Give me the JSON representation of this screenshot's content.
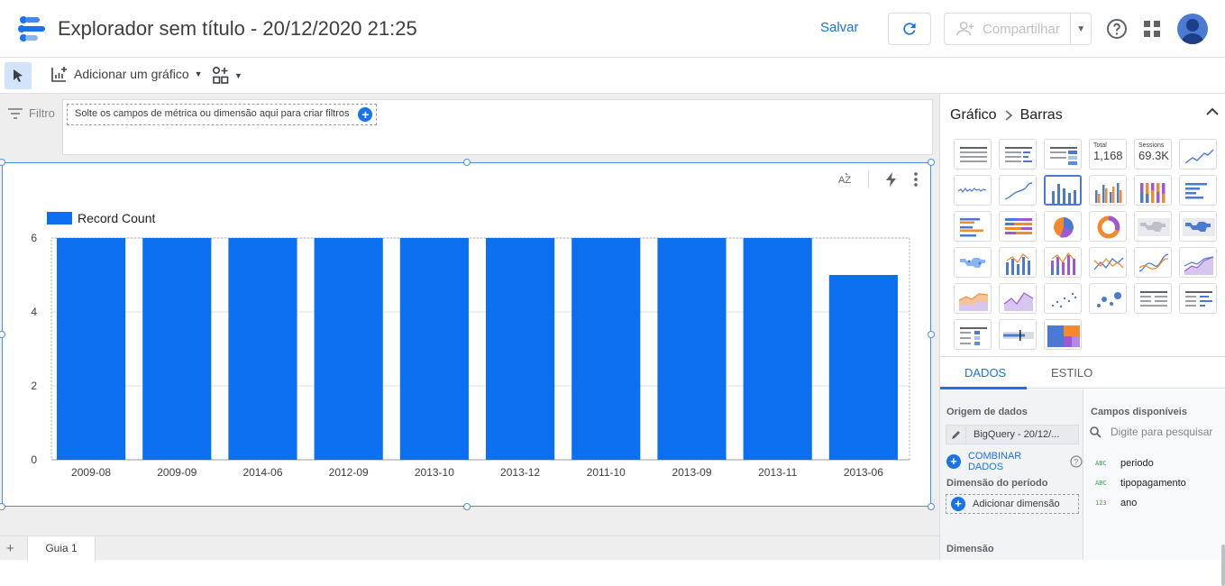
{
  "header": {
    "title": "Explorador sem título - 20/12/2020 21:25",
    "save_label": "Salvar",
    "share_label": "Compartilhar"
  },
  "toolbar": {
    "add_chart_label": "Adicionar um gráfico"
  },
  "filter": {
    "label": "Filtro",
    "drop_hint": "Solte os campos de métrica ou dimensão aqui para criar filtros"
  },
  "pages": {
    "tab_label": "Guia 1"
  },
  "panel": {
    "breadcrumb_root": "Gráfico",
    "breadcrumb_current": "Barras",
    "scorecard_total_label": "Total",
    "scorecard_total_value": "1,168",
    "scorecard_sessions_label": "Sessions",
    "scorecard_sessions_value": "69.3K",
    "tab_data": "DADOS",
    "tab_style": "ESTILO",
    "data_source_label": "Origem de dados",
    "data_source_value": "BigQuery - 20/12/...",
    "combine_label": "COMBINAR DADOS",
    "period_dimension_label": "Dimensão do período",
    "add_dimension_label": "Adicionar dimensão",
    "dimension_label": "Dimensão",
    "available_fields_label": "Campos disponíveis",
    "search_placeholder": "Digite para pesquisar",
    "fields": [
      {
        "type": "ABC",
        "name": "periodo"
      },
      {
        "type": "ABC",
        "name": "tipopagamento"
      },
      {
        "type": "123",
        "name": "ano"
      }
    ]
  },
  "colors": {
    "accent": "#1a73e8",
    "bar": "#0c6ff0"
  },
  "chart_data": {
    "type": "bar",
    "categories": [
      "2009-08",
      "2009-09",
      "2014-06",
      "2012-09",
      "2013-10",
      "2013-12",
      "2011-10",
      "2013-09",
      "2013-11",
      "2013-06"
    ],
    "series": [
      {
        "name": "Record Count",
        "values": [
          6,
          6,
          6,
          6,
          6,
          6,
          6,
          6,
          6,
          5
        ]
      }
    ],
    "y_ticks": [
      "0",
      "2",
      "4",
      "6"
    ],
    "ylim": [
      0,
      6
    ],
    "grid": true,
    "legend_position": "top-left",
    "legend_label": "Record Count"
  }
}
